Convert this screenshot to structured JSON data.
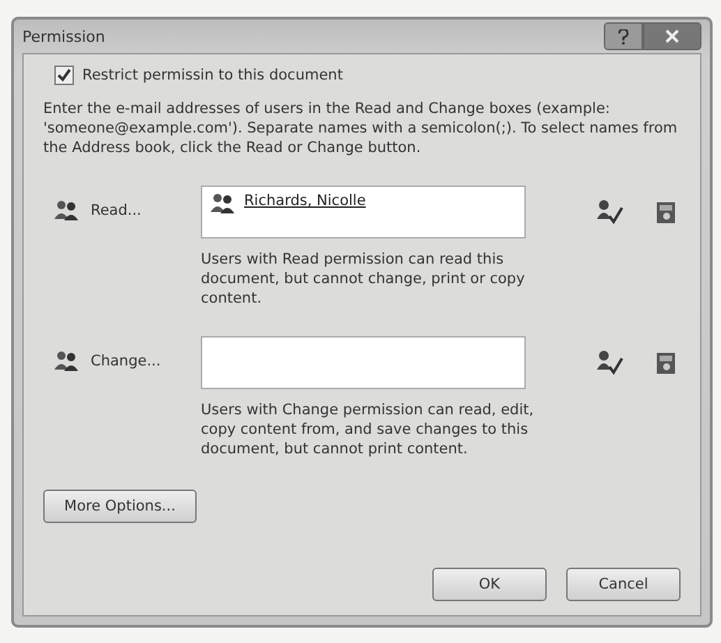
{
  "window": {
    "title": "Permission"
  },
  "restrict": {
    "label": "Restrict permissin to this document",
    "checked": true
  },
  "instructions": "Enter the e-mail addresses of users in the Read and Change boxes (example: 'someone@example.com'). Separate names with a semicolon(;). To select names from the Address book, click the Read or Change button.",
  "permissions": [
    {
      "label": "Read...",
      "users": [
        "Richards, Nicolle"
      ],
      "description": "Users with Read permission can read this document, but cannot change, print or copy content."
    },
    {
      "label": "Change...",
      "description": "Users with Change permission can read, edit, copy content from, and save changes to this document, but cannot print content."
    }
  ],
  "buttons": {
    "more": "More Options...",
    "ok": "OK",
    "cancel": "Cancel"
  }
}
